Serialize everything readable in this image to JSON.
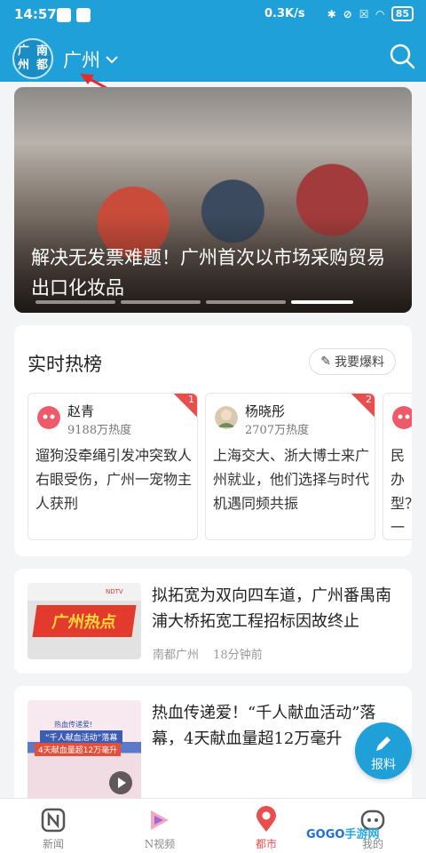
{
  "status_bar": {
    "time": "14:57",
    "network_speed": "0.3K/s",
    "battery": "85"
  },
  "header": {
    "logo_chars": [
      "广",
      "南",
      "州",
      "都"
    ],
    "city": "广州",
    "accent": "#1fa0d8"
  },
  "banner": {
    "headline": "解决无发票难题！广州首次以市场采购贸易出口化妆品"
  },
  "hot_list": {
    "title": "实时热榜",
    "report_label": "我要爆料",
    "items": [
      {
        "rank": "1",
        "name": "赵青",
        "heat": "9188万热度",
        "text": "遛狗没牵绳引发冲突致人右眼受伤，广州一宠物主人获刑"
      },
      {
        "rank": "2",
        "name": "杨晓彤",
        "heat": "2707万热度",
        "text": "上海交大、浙大博士来广州就业，他们选择与时代机遇同频共振"
      },
      {
        "rank": "",
        "name": "",
        "heat": "",
        "text": "民办型？一生"
      }
    ]
  },
  "news": [
    {
      "title": "拟拓宽为双向四车道，广州番禺南浦大桥拓宽工程招标因故终止",
      "source": "南都广州",
      "time": "18分钟前",
      "thumb": {
        "headline": "广州热点",
        "tag": "NDTV"
      }
    },
    {
      "title": "热血传递爱！“千人献血活动”落幕，4天献血量超12万毫升",
      "thumb": {
        "line1": "热血传递爱!",
        "line2": "“千人献血活动”落幕",
        "line3": "4天献血量超12万毫升"
      }
    }
  ],
  "fab": {
    "label": "报料"
  },
  "bottom_nav": [
    {
      "label": "新闻",
      "icon": "news-icon"
    },
    {
      "label": "N视频",
      "icon": "video-icon"
    },
    {
      "label": "都市",
      "icon": "location-icon",
      "active": true
    },
    {
      "label": "我的",
      "icon": "profile-icon"
    }
  ],
  "watermark": {
    "a": "GOGO",
    "b": "手游网"
  }
}
